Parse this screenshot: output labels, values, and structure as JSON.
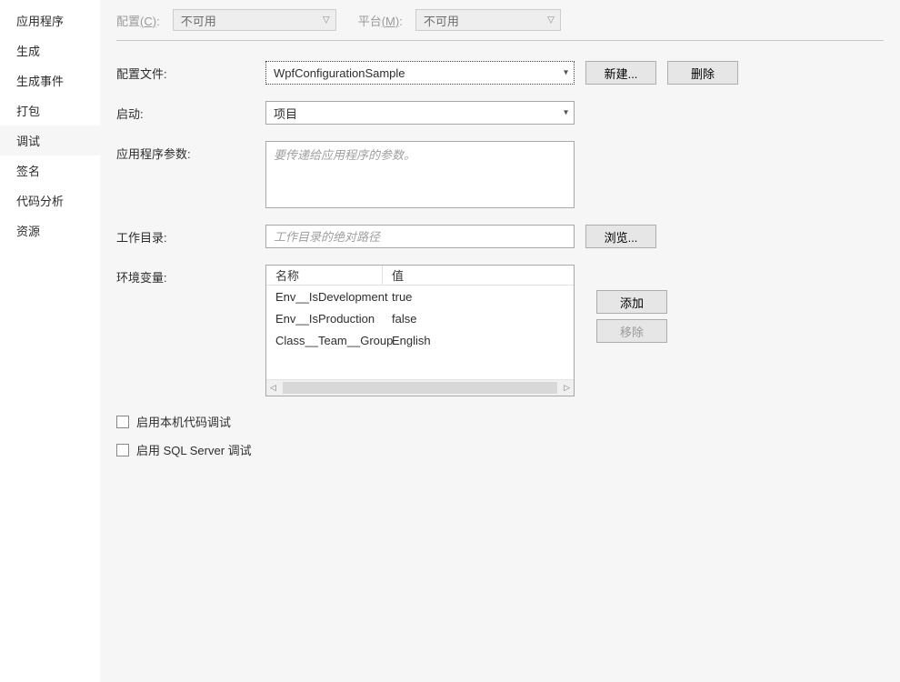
{
  "sidebar": {
    "items": [
      {
        "label": "应用程序"
      },
      {
        "label": "生成"
      },
      {
        "label": "生成事件"
      },
      {
        "label": "打包"
      },
      {
        "label": "调试"
      },
      {
        "label": "签名"
      },
      {
        "label": "代码分析"
      },
      {
        "label": "资源"
      }
    ],
    "active_index": 4
  },
  "top": {
    "config_label_prefix": "配置",
    "config_hotkey": "(C)",
    "config_suffix": ":",
    "config_value": "不可用",
    "platform_label_prefix": "平台",
    "platform_hotkey": "(M)",
    "platform_suffix": ":",
    "platform_value": "不可用"
  },
  "form": {
    "profile": {
      "label": "配置文件:",
      "value": "WpfConfigurationSample"
    },
    "new_button": "新建...",
    "delete_button": "删除",
    "launch": {
      "label": "启动:",
      "value": "项目"
    },
    "args": {
      "label": "应用程序参数:",
      "placeholder": "要传递给应用程序的参数。"
    },
    "workdir": {
      "label": "工作目录:",
      "placeholder": "工作目录的绝对路径"
    },
    "browse_button": "浏览...",
    "env": {
      "label": "环境变量:",
      "col_name": "名称",
      "col_value": "值",
      "rows": [
        {
          "name": "Env__IsDevelopment",
          "value": "true"
        },
        {
          "name": "Env__IsProduction",
          "value": "false"
        },
        {
          "name": "Class__Team__Group",
          "value": "English"
        }
      ],
      "add_button": "添加",
      "remove_button": "移除"
    },
    "native_debug": "启用本机代码调试",
    "sql_debug": "启用 SQL Server 调试"
  }
}
